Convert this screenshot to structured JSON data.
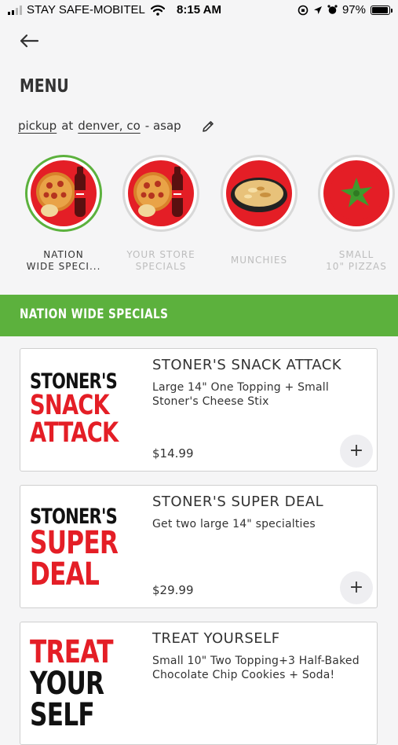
{
  "status_bar": {
    "carrier": "STAY SAFE-MOBITEL",
    "time": "8:15 AM",
    "battery": "97%",
    "battery_level": 0.97
  },
  "header": {
    "back_icon": "arrow-left-icon",
    "title": "MENU",
    "order_mode": "pickup",
    "at_text": "at",
    "location": "denver, co",
    "when": "- asap",
    "edit_icon": "pencil-icon"
  },
  "categories": [
    {
      "label_line1": "NATION",
      "label_line2": "WIDE SPECI...",
      "active": true,
      "image": "pizza-and-soda"
    },
    {
      "label_line1": "YOUR STORE",
      "label_line2": "SPECIALS",
      "active": false,
      "image": "pizza-and-soda"
    },
    {
      "label_line1": "MUNCHIES",
      "label_line2": "",
      "active": false,
      "image": "baked-dish"
    },
    {
      "label_line1": "SMALL",
      "label_line2": "10\" PIZZAS",
      "active": false,
      "image": "tomato"
    }
  ],
  "section": {
    "title": "NATION WIDE SPECIALS"
  },
  "products": [
    {
      "logo_lines": [
        "STONER'S",
        "SNACK",
        "ATTACK"
      ],
      "title": "STONER'S SNACK ATTACK",
      "description": "Large 14\" One Topping + Small Stoner's Cheese Stix",
      "price": "$14.99",
      "add_label": "+"
    },
    {
      "logo_lines": [
        "STONER'S",
        "SUPER",
        "DEAL"
      ],
      "title": "STONER'S SUPER DEAL",
      "description": "Get two large 14\" specialties",
      "price": "$29.99",
      "add_label": "+"
    },
    {
      "logo_lines": [
        "TREAT",
        "YOUR",
        "SELF"
      ],
      "title": "TREAT YOURSELF",
      "description": "Small 10\" Two Topping+3 Half-Baked Chocolate Chip Cookies + Soda!",
      "price": "",
      "add_label": "+"
    }
  ],
  "colors": {
    "accent_green": "#5cb13d",
    "brand_red": "#e41e26",
    "background": "#f5f5f6"
  }
}
